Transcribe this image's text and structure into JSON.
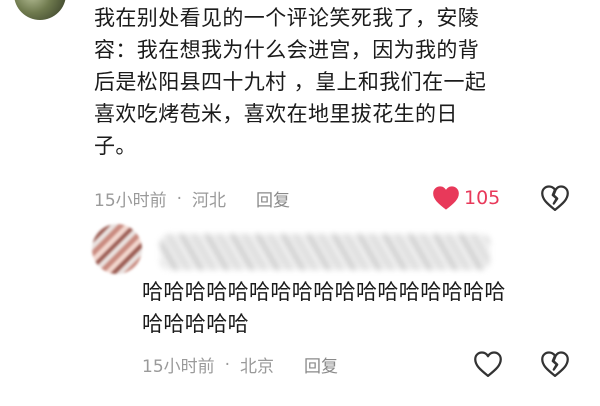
{
  "comment": {
    "text": "我在别处看见的一个评论笑死我了，安陵\n容：我在想我为什么会进宫，因为我的背\n后是松阳县四十九村 ，皇上和我们在一起\n喜欢吃烤苞米，喜欢在地里拔花生的日\n子。",
    "time": "15小时前",
    "separator": "·",
    "location": "河北",
    "reply_label": "回复",
    "like_count": "105",
    "liked": true,
    "like_color": "#e8395a",
    "icons": [
      "heart-filled-icon",
      "broken-heart-icon"
    ]
  },
  "reply": {
    "text": "哈哈哈哈哈哈哈哈哈哈哈哈哈哈哈哈哈\n哈哈哈哈哈",
    "time": "15小时前",
    "separator": "·",
    "location": "北京",
    "reply_label": "回复",
    "icons": [
      "heart-outline-icon",
      "broken-heart-icon"
    ]
  }
}
